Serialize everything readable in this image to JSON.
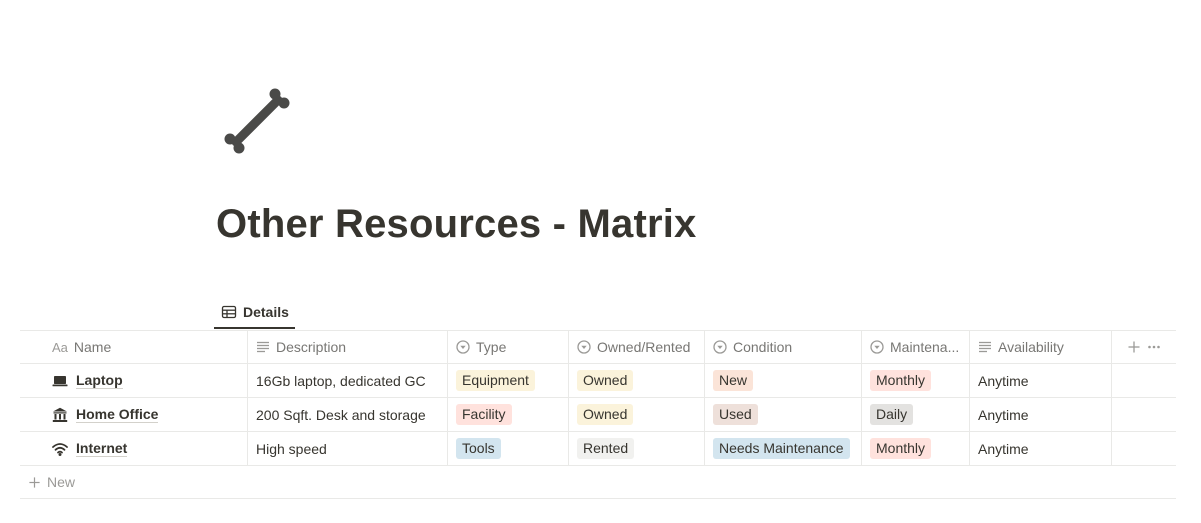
{
  "page": {
    "icon": "bone-icon",
    "title": "Other Resources - Matrix"
  },
  "view_tab": {
    "label": "Details",
    "icon": "table-icon"
  },
  "columns": [
    {
      "key": "name",
      "label": "Name",
      "icon": "text-aa-icon"
    },
    {
      "key": "description",
      "label": "Description",
      "icon": "lines-icon"
    },
    {
      "key": "type",
      "label": "Type",
      "icon": "select-icon"
    },
    {
      "key": "owned",
      "label": "Owned/Rented",
      "icon": "select-icon"
    },
    {
      "key": "condition",
      "label": "Condition",
      "icon": "select-icon"
    },
    {
      "key": "maintenance",
      "label": "Maintena...",
      "icon": "select-icon"
    },
    {
      "key": "availability",
      "label": "Availability",
      "icon": "lines-icon"
    }
  ],
  "header_actions": {
    "add": "plus-icon",
    "more": "more-icon"
  },
  "rows": [
    {
      "icon": "laptop-icon",
      "name": "Laptop",
      "description": "16Gb laptop, dedicated GC",
      "type": {
        "label": "Equipment",
        "bg": "#fbf3db",
        "fg": "#37352f"
      },
      "owned": {
        "label": "Owned",
        "bg": "#fbf3db",
        "fg": "#37352f"
      },
      "condition": {
        "label": "New",
        "bg": "#fbe4d8",
        "fg": "#37352f"
      },
      "maintenance": {
        "label": "Monthly",
        "bg": "#ffe2dd",
        "fg": "#37352f"
      },
      "availability": "Anytime"
    },
    {
      "icon": "building-icon",
      "name": "Home Office",
      "description": "200 Sqft. Desk and storage",
      "type": {
        "label": "Facility",
        "bg": "#ffe2dd",
        "fg": "#37352f"
      },
      "owned": {
        "label": "Owned",
        "bg": "#fbf3db",
        "fg": "#37352f"
      },
      "condition": {
        "label": "Used",
        "bg": "#eee0da",
        "fg": "#37352f"
      },
      "maintenance": {
        "label": "Daily",
        "bg": "#e3e2e0",
        "fg": "#37352f"
      },
      "availability": "Anytime"
    },
    {
      "icon": "wifi-icon",
      "name": "Internet",
      "description": "High speed",
      "type": {
        "label": "Tools",
        "bg": "#d3e5ef",
        "fg": "#37352f"
      },
      "owned": {
        "label": "Rented",
        "bg": "#f1f1ef",
        "fg": "#37352f"
      },
      "condition": {
        "label": "Needs Maintenance",
        "bg": "#d3e5ef",
        "fg": "#37352f"
      },
      "maintenance": {
        "label": "Monthly",
        "bg": "#ffe2dd",
        "fg": "#37352f"
      },
      "availability": "Anytime"
    }
  ],
  "new_row": {
    "label": "New",
    "icon": "plus-icon"
  }
}
